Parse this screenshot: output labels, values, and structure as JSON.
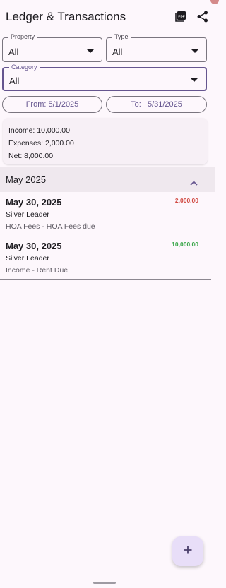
{
  "appbar": {
    "title": "Ledger & Transactions",
    "icons": [
      "pdf-icon",
      "share-icon"
    ]
  },
  "filters": {
    "property": {
      "label": "Property",
      "value": "All"
    },
    "type": {
      "label": "Type",
      "value": "All"
    },
    "category": {
      "label": "Category",
      "value": "All"
    }
  },
  "dates": {
    "from": "From: 5/1/2025",
    "to": "To:   5/31/2025"
  },
  "summary": {
    "income": "Income: 10,000.00",
    "expenses": "Expenses: 2,000.00",
    "net": "Net: 8,000.00"
  },
  "month_group": {
    "label": "May 2025",
    "expanded": true
  },
  "transactions": [
    {
      "date": "May 30, 2025",
      "name": "Silver Leader",
      "desc": "HOA Fees - HOA Fees due",
      "amount": "2,000.00",
      "kind": "expense"
    },
    {
      "date": "May 30, 2025",
      "name": "Silver Leader",
      "desc": "Income - Rent Due",
      "amount": "10,000.00",
      "kind": "income"
    }
  ],
  "colors": {
    "background": "#fdf7fc",
    "accent": "#65558f",
    "expense": "#d14a42",
    "income": "#3aa74a",
    "fab": "#e8def8"
  },
  "fab": {
    "icon": "plus-icon"
  }
}
